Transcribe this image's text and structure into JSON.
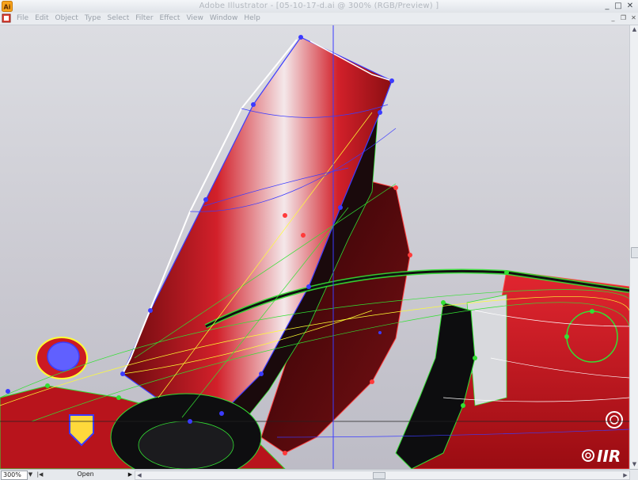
{
  "window": {
    "title": "Adobe Illustrator - [05-10-17-d.ai @ 300% (RGB/Preview) ]",
    "app_icon": "illustrator-icon",
    "controls": {
      "minimize": "_",
      "maximize": "□",
      "close": "✕"
    }
  },
  "menubar": {
    "items": [
      "File",
      "Edit",
      "Object",
      "Type",
      "Select",
      "Filter",
      "Effect",
      "View",
      "Window",
      "Help"
    ],
    "doc_controls": {
      "minimize": "_",
      "restore": "❐",
      "close": "✕"
    }
  },
  "statusbar": {
    "zoom": "300%",
    "status_text": "Open"
  },
  "artwork": {
    "watermark": "IIR",
    "colors": {
      "red": "#c8141e",
      "dark_red": "#5a0608",
      "blue": "#3b3bff",
      "green": "#33e033",
      "yellow": "#ffff33"
    }
  },
  "icons": {
    "scroll_up": "▲",
    "scroll_down": "▼",
    "scroll_left": "◀",
    "scroll_right": "▶",
    "dropdown": "▼",
    "first_page": "|◀",
    "status_menu": "▶"
  }
}
